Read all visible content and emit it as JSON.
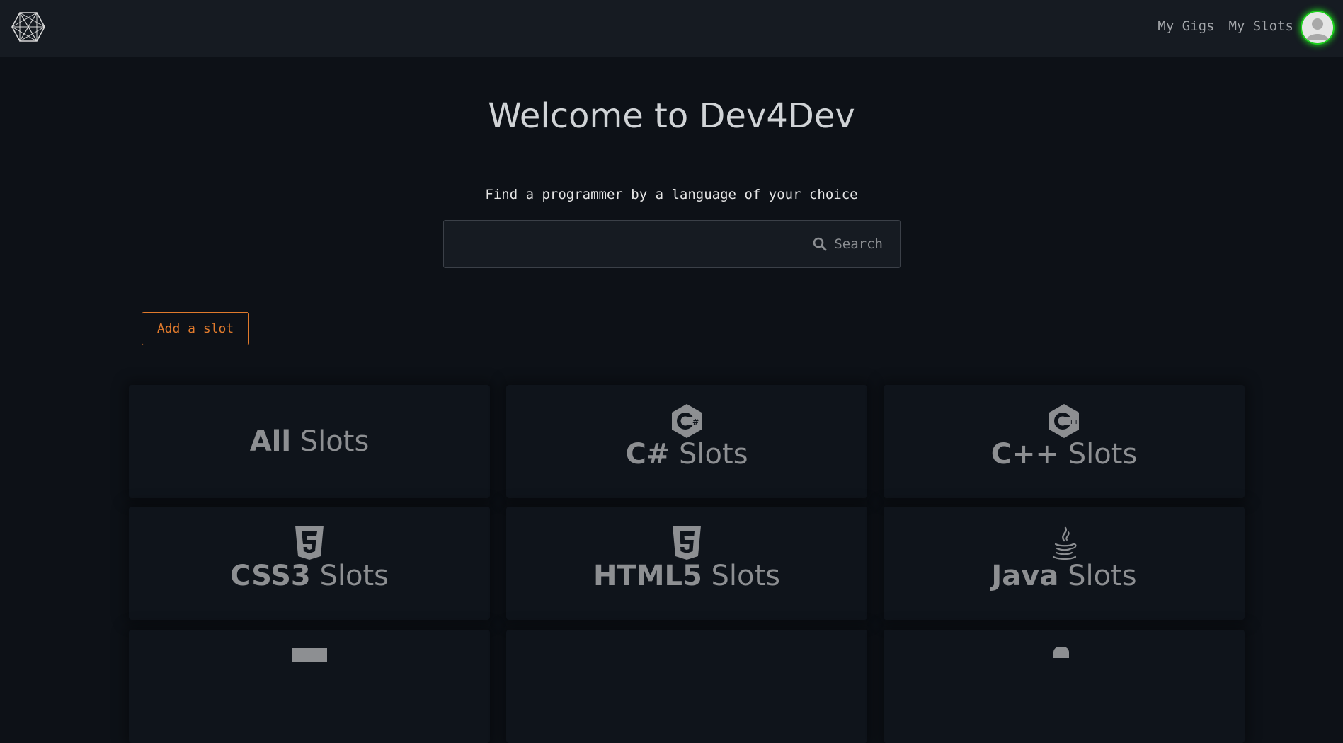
{
  "nav": {
    "links": [
      "My Gigs",
      "My Slots"
    ],
    "logo_icon": "hexagon-logo-icon",
    "avatar_icon": "user-avatar-icon",
    "avatar_ring_color": "#1fcf1f"
  },
  "hero": {
    "title": "Welcome to Dev4Dev",
    "subtitle": "Find a programmer by a language of your choice"
  },
  "search": {
    "value": "",
    "button_label": "Search",
    "icon": "search-icon"
  },
  "actions": {
    "add_slot_label": "Add a slot",
    "accent_color": "#e07a2c"
  },
  "cards": [
    {
      "bold": "All",
      "rest": " Slots",
      "icon": null
    },
    {
      "bold": "C#",
      "rest": " Slots",
      "icon": "csharp-icon"
    },
    {
      "bold": "C++",
      "rest": " Slots",
      "icon": "cplusplus-icon"
    },
    {
      "bold": "CSS3",
      "rest": " Slots",
      "icon": "css3-icon"
    },
    {
      "bold": "HTML5",
      "rest": " Slots",
      "icon": "html5-icon"
    },
    {
      "bold": "Java",
      "rest": " Slots",
      "icon": "java-icon"
    }
  ]
}
